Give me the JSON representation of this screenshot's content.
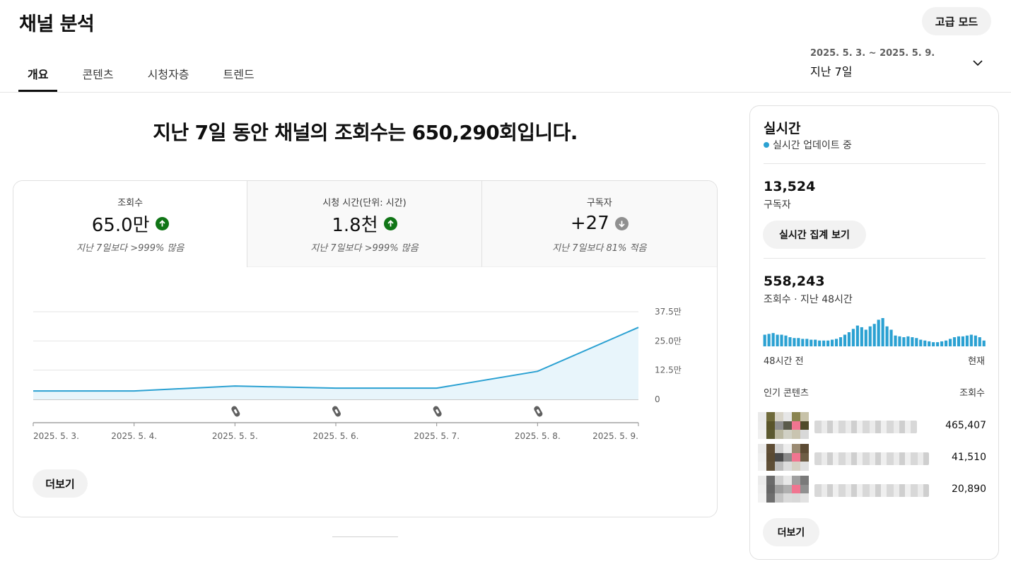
{
  "header": {
    "title": "채널 분석",
    "advanced_mode": "고급 모드",
    "tabs": [
      "개요",
      "콘텐츠",
      "시청자층",
      "트렌드"
    ],
    "date_range": "2025. 5. 3. ~ 2025. 5. 9.",
    "range_label": "지난 7일"
  },
  "main": {
    "headline": "지난 7일 동안 채널의 조회수는 650,290회입니다.",
    "metrics": [
      {
        "label": "조회수",
        "value": "65.0만",
        "trend": "up",
        "sub": "지난 7일보다 >999% 많음"
      },
      {
        "label": "시청 시간(단위: 시간)",
        "value": "1.8천",
        "trend": "up",
        "sub": "지난 7일보다 >999% 많음"
      },
      {
        "label": "구독자",
        "value": "+27",
        "trend": "down",
        "sub": "지난 7일보다 81% 적음"
      }
    ],
    "more_label": "더보기"
  },
  "chart_data": {
    "type": "area",
    "x": [
      "2025. 5. 3.",
      "2025. 5. 4.",
      "2025. 5. 5.",
      "2025. 5. 6.",
      "2025. 5. 7.",
      "2025. 5. 8.",
      "2025. 5. 9."
    ],
    "values": [
      36000,
      36000,
      57000,
      48000,
      48000,
      120000,
      308000
    ],
    "y_ticks": [
      "0",
      "12.5만",
      "25.0만",
      "37.5만"
    ],
    "ylim": [
      0,
      375000
    ],
    "grid": true,
    "color": "#2ba1d2",
    "shorts_markers": [
      2,
      3,
      4,
      5
    ]
  },
  "sidebar": {
    "title": "실시간",
    "status": "실시간 업데이트 중",
    "subscribers": "13,524",
    "subscribers_label": "구독자",
    "rt_button": "실시간 집계 보기",
    "views": "558,243",
    "views_label": "조회수 · 지난 48시간",
    "mini_chart": {
      "type": "bar",
      "values": [
        14,
        15,
        16,
        14,
        14,
        13,
        11,
        10,
        10,
        9,
        9,
        8,
        8,
        7,
        7,
        7,
        8,
        9,
        11,
        14,
        17,
        21,
        25,
        23,
        20,
        24,
        27,
        32,
        34,
        24,
        20,
        13,
        12,
        11,
        12,
        11,
        10,
        8,
        7,
        6,
        5,
        5,
        6,
        7,
        9,
        11,
        12,
        12,
        13,
        14,
        13,
        11,
        7
      ],
      "color": "#2ba1d2"
    },
    "mini_left": "48시간 전",
    "mini_right": "현재",
    "popular_head": "인기 콘텐츠",
    "popular_head_right": "조회수",
    "popular": [
      {
        "views": "465,407"
      },
      {
        "views": "41,510"
      },
      {
        "views": "20,890"
      }
    ],
    "more_label": "더보기"
  }
}
